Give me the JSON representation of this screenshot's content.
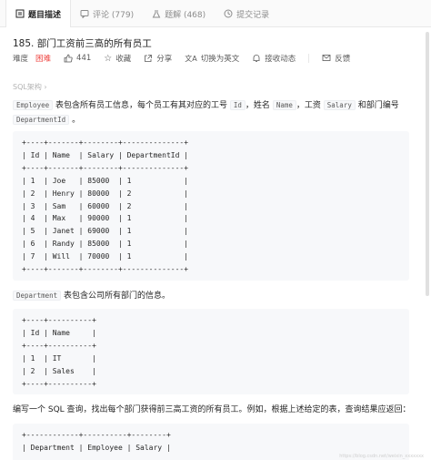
{
  "tabs": [
    {
      "label": "题目描述",
      "icon": "document-icon",
      "active": true
    },
    {
      "label": "评论 (779)",
      "icon": "comment-icon",
      "active": false
    },
    {
      "label": "题解 (468)",
      "icon": "flask-icon",
      "active": false
    },
    {
      "label": "提交记录",
      "icon": "history-icon",
      "active": false
    }
  ],
  "problem": {
    "title": "185. 部门工资前三高的所有员工",
    "difficulty_label": "难度",
    "difficulty": "困难",
    "likes": "441",
    "favorite": "收藏",
    "share": "分享",
    "switch_lang": "切换为英文",
    "follow": "接收动态",
    "feedback": "反馈"
  },
  "tagline": "SQL架构 ›",
  "para1": {
    "before": "表包含所有员工信息，每个员工有其对应的工号",
    "t_employee": "Employee",
    "id": "Id",
    "mid1": "，姓名",
    "name": "Name",
    "mid2": "，工资",
    "salary": "Salary",
    "mid3": "和部门编号",
    "deptid": "DepartmentId",
    "end": "。"
  },
  "table_employee": "+----+-------+--------+--------------+\n| Id | Name  | Salary | DepartmentId |\n+----+-------+--------+--------------+\n| 1  | Joe   | 85000  | 1            |\n| 2  | Henry | 80000  | 2            |\n| 3  | Sam   | 60000  | 2            |\n| 4  | Max   | 90000  | 1            |\n| 5  | Janet | 69000  | 1            |\n| 6  | Randy | 85000  | 1            |\n| 7  | Will  | 70000  | 1            |\n+----+-------+--------+--------------+",
  "para2": {
    "t_department": "Department",
    "text": "表包含公司所有部门的信息。"
  },
  "table_department": "+----+----------+\n| Id | Name     |\n+----+----------+\n| 1  | IT       |\n| 2  | Sales    |\n+----+----------+",
  "para3": "编写一个 SQL 查询，找出每个部门获得前三高工资的所有员工。例如，根据上述给定的表，查询结果应返回：",
  "table_result": "+------------+----------+--------+\n| Department | Employee | Salary |",
  "watermark": "https://blog.csdn.net/weixin_xxxxxxx"
}
